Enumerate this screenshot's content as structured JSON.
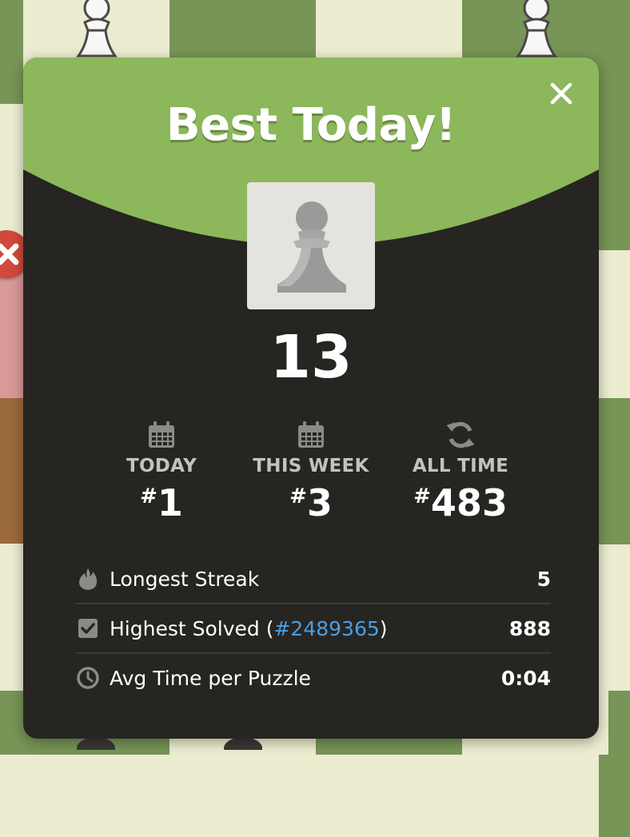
{
  "modal": {
    "title": "Best Today!",
    "score": "13"
  },
  "ranks": [
    {
      "label": "TODAY",
      "hash": "#",
      "value": "1",
      "icon": "calendar-icon"
    },
    {
      "label": "THIS WEEK",
      "hash": "#",
      "value": "3",
      "icon": "calendar-icon"
    },
    {
      "label": "ALL TIME",
      "hash": "#",
      "value": "483",
      "icon": "refresh-icon"
    }
  ],
  "stats": {
    "longest_streak": {
      "label": "Longest Streak",
      "value": "5",
      "icon": "flame-icon"
    },
    "highest_solved": {
      "label_prefix": "Highest Solved (",
      "link": "#2489365",
      "label_suffix": ")",
      "value": "888",
      "icon": "checkbox-icon"
    },
    "avg_time": {
      "label": "Avg Time per Puzzle",
      "value": "0:04",
      "icon": "clock-icon"
    }
  },
  "colors": {
    "header_green": "#8cb75b",
    "modal_bg": "#262522",
    "board_dark": "#779556",
    "board_light": "#ebecd0",
    "link_blue": "#4a9ee3"
  }
}
